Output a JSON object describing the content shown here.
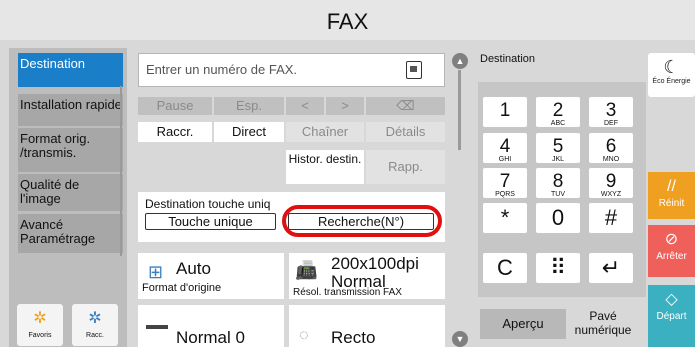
{
  "header": {
    "title": "FAX"
  },
  "sidebar": {
    "items": [
      {
        "label": "Destination"
      },
      {
        "label": "Installation rapide"
      },
      {
        "label": "Format orig. /transmis."
      },
      {
        "label": "Qualité de l'image"
      },
      {
        "label": "Avancé Paramétrage"
      }
    ],
    "favorites": [
      {
        "label": "Favoris",
        "icon": "star-icon"
      },
      {
        "label": "Racc.",
        "icon": "star-icon"
      }
    ]
  },
  "fax_input": {
    "placeholder": "Entrer un numéro de FAX."
  },
  "toolbar": {
    "row1": [
      "Pause",
      "Esp.",
      "<",
      ">",
      "⌫"
    ],
    "row2": [
      "Raccr.",
      "Direct",
      "Chaîner",
      "Détails"
    ],
    "histor": "Histor. destin.",
    "rapp": "Rapp."
  },
  "dest_panel": {
    "label": "Destination touche uniq",
    "touche_unique": "Touche unique",
    "recherche": "Recherche(N°)"
  },
  "cards": [
    {
      "value": "Auto",
      "label": "Format d'origine",
      "icon": "document-icon"
    },
    {
      "value": "200x100dpi Normal",
      "label": "Résol. transmission FAX",
      "icon": "fax-resolution-icon"
    },
    {
      "value": "Normal 0",
      "icon": "density-icon"
    },
    {
      "value": "Recto",
      "icon": "duplex-icon"
    }
  ],
  "keypad": {
    "label": "Destination",
    "keys": [
      {
        "num": "1",
        "sub": ""
      },
      {
        "num": "2",
        "sub": "ABC"
      },
      {
        "num": "3",
        "sub": "DEF"
      },
      {
        "num": "4",
        "sub": "GHI"
      },
      {
        "num": "5",
        "sub": "JKL"
      },
      {
        "num": "6",
        "sub": "MNO"
      },
      {
        "num": "7",
        "sub": "PQRS"
      },
      {
        "num": "8",
        "sub": "TUV"
      },
      {
        "num": "9",
        "sub": "WXYZ"
      },
      {
        "num": "*",
        "sub": ""
      },
      {
        "num": "0",
        "sub": ""
      },
      {
        "num": "#",
        "sub": ""
      },
      {
        "num": "C",
        "sub": ""
      },
      {
        "num": "⠿",
        "sub": ""
      },
      {
        "num": "↵",
        "sub": ""
      }
    ],
    "apercu": "Aperçu",
    "pave": "Pavé numérique"
  },
  "right_panel": {
    "eco": "Éco Énergie",
    "reinit": "Réinit",
    "arret": "Arrêter",
    "depart": "Départ"
  },
  "colors": {
    "accent_blue": "#1a7ec8",
    "reinit_orange": "#f0a020",
    "stop_red": "#f0605a",
    "start_teal": "#3ab0c0",
    "highlight_red": "#e01010"
  }
}
